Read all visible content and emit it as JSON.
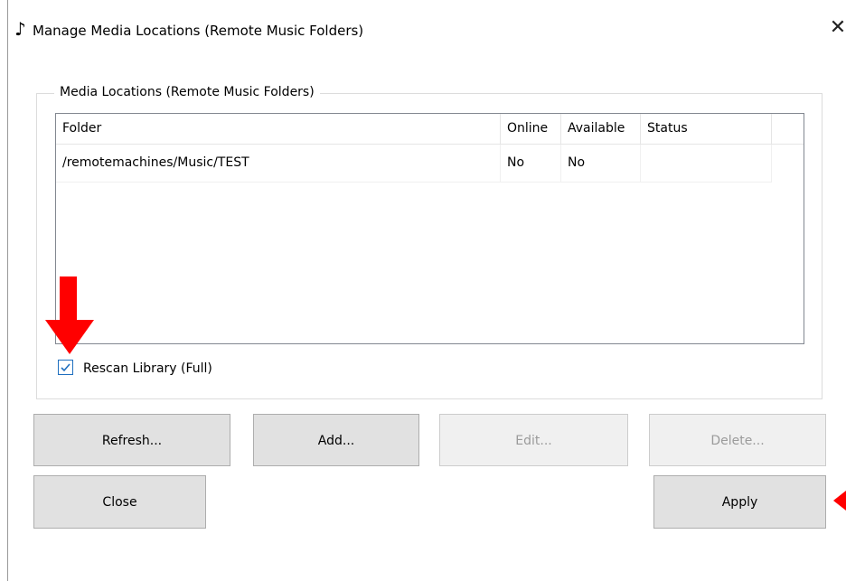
{
  "window": {
    "title": "Manage Media Locations (Remote Music Folders)",
    "app_icon": "music-note-icon",
    "close_glyph": "✕"
  },
  "group": {
    "legend": "Media Locations (Remote Music Folders)"
  },
  "table": {
    "columns": [
      "Folder",
      "Online",
      "Available",
      "Status"
    ],
    "rows": [
      {
        "folder": "/remotemachines/Music/TEST",
        "online": "No",
        "available": "No",
        "status": ""
      }
    ]
  },
  "rescan": {
    "label": "Rescan Library (Full)",
    "checked": true
  },
  "buttons": {
    "refresh": "Refresh...",
    "add": "Add...",
    "edit": "Edit...",
    "delete": "Delete...",
    "close": "Close",
    "apply": "Apply"
  },
  "annotation": {
    "arrow_color": "#ff0000"
  }
}
